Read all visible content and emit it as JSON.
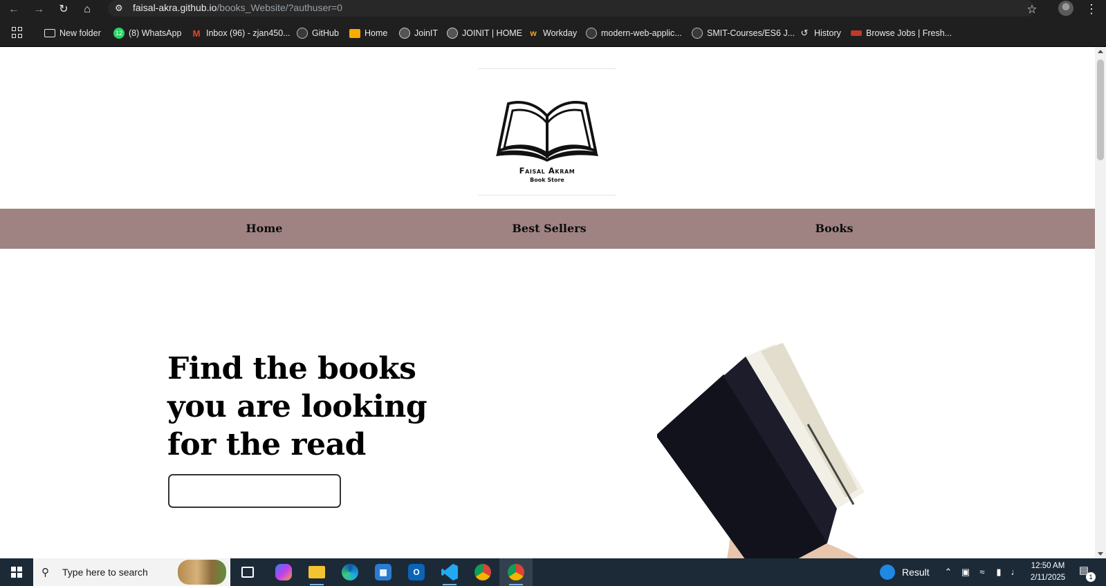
{
  "browser": {
    "url_host": "faisal-akra.github.io",
    "url_path": "/books_Website/?authuser=0",
    "bookmarks": [
      {
        "label": "New folder",
        "icon": "folder-icon"
      },
      {
        "label": "(8) WhatsApp",
        "icon": "whatsapp-icon",
        "badge": "12"
      },
      {
        "label": "Inbox (96) - zjan450...",
        "icon": "gmail-icon"
      },
      {
        "label": "GitHub",
        "icon": "github-icon"
      },
      {
        "label": "Home",
        "icon": "classroom-icon"
      },
      {
        "label": "JoinIT",
        "icon": "globe-icon"
      },
      {
        "label": "JOINIT | HOME",
        "icon": "globe-icon"
      },
      {
        "label": "Workday",
        "icon": "workday-icon"
      },
      {
        "label": "modern-web-applic...",
        "icon": "github-icon"
      },
      {
        "label": "SMIT-Courses/ES6 J...",
        "icon": "github-icon"
      },
      {
        "label": "History",
        "icon": "history-icon"
      },
      {
        "label": "Browse Jobs | Fresh...",
        "icon": "rozee-icon"
      }
    ]
  },
  "site": {
    "logo": {
      "brand": "Faisal Akram",
      "subtitle": "Book Store"
    },
    "nav": [
      {
        "label": "Home"
      },
      {
        "label": "Best Sellers"
      },
      {
        "label": "Books"
      }
    ],
    "hero": {
      "title_lines": [
        "Find the books",
        "you are looking",
        "for the read"
      ],
      "search_value": ""
    }
  },
  "taskbar": {
    "search_placeholder": "Type here to search",
    "weather_label": "Result",
    "time": "12:50 AM",
    "date": "2/11/2025",
    "notification_count": "1"
  },
  "colors": {
    "navbar_bg": "#9f8382",
    "chrome_bg": "#1f1f1f",
    "taskbar_bg": "#1c2a38"
  }
}
